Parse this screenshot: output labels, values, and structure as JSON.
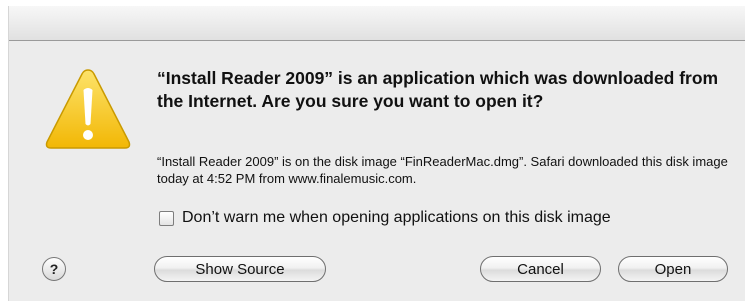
{
  "dialog": {
    "headline": "“Install Reader 2009” is an application which was downloaded from the Internet. Are you sure you want to open it?",
    "details": "“Install Reader 2009” is on the disk image “FinReaderMac.dmg”. Safari downloaded this disk image today at 4:52 PM from www.finalemusic.com.",
    "checkbox_label": "Don’t warn me when opening applications on this disk image",
    "checkbox_checked": false,
    "icon": "warning-triangle-icon",
    "help_label": "?",
    "buttons": {
      "show_source": "Show Source",
      "cancel": "Cancel",
      "open": "Open"
    }
  },
  "colors": {
    "warning_yellow": "#f7c81a",
    "dialog_background": "#ececec"
  }
}
